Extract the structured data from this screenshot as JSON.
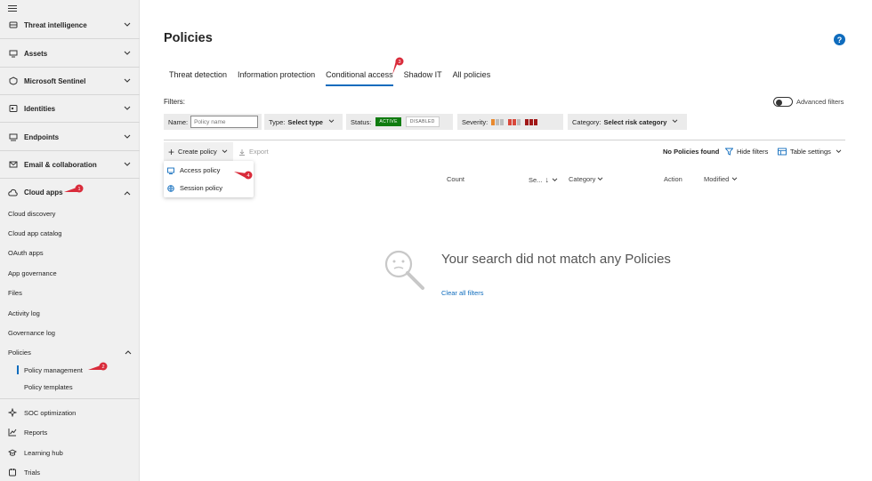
{
  "sidebar": {
    "groups": [
      {
        "label": "Threat intelligence",
        "icon": "shield-bug-icon"
      },
      {
        "label": "Assets",
        "icon": "assets-icon"
      },
      {
        "label": "Microsoft Sentinel",
        "icon": "sentinel-icon"
      },
      {
        "label": "Identities",
        "icon": "identities-icon"
      },
      {
        "label": "Endpoints",
        "icon": "endpoints-icon"
      },
      {
        "label": "Email & collaboration",
        "icon": "mail-icon"
      },
      {
        "label": "Cloud apps",
        "icon": "cloud-icon"
      }
    ],
    "cloud_apps_items": [
      "Cloud discovery",
      "Cloud app catalog",
      "OAuth apps",
      "App governance",
      "Files",
      "Activity log",
      "Governance log"
    ],
    "policies_label": "Policies",
    "policies_items": [
      "Policy management",
      "Policy templates"
    ],
    "bottom_items": [
      {
        "label": "SOC optimization",
        "icon": "soc-icon"
      },
      {
        "label": "Reports",
        "icon": "reports-icon"
      },
      {
        "label": "Learning hub",
        "icon": "learning-icon"
      },
      {
        "label": "Trials",
        "icon": "trials-icon"
      }
    ]
  },
  "callouts": [
    "1",
    "2",
    "3",
    "4"
  ],
  "page": {
    "title": "Policies",
    "help": "?",
    "tabs": [
      "Threat detection",
      "Information protection",
      "Conditional access",
      "Shadow IT",
      "All policies"
    ],
    "active_tab": "Conditional access"
  },
  "filters": {
    "label": "Filters:",
    "advanced_label": "Advanced filters",
    "name_label": "Name:",
    "name_placeholder": "Policy name",
    "type_label": "Type:",
    "type_value": "Select type",
    "status_label": "Status:",
    "status_active": "ACTIVE",
    "status_disabled": "DISABLED",
    "severity_label": "Severity:",
    "category_label": "Category:",
    "category_value": "Select risk category"
  },
  "toolbar": {
    "create_label": "Create policy",
    "export_label": "Export",
    "no_policies": "No Policies found",
    "hide_filters": "Hide filters",
    "table_settings": "Table settings"
  },
  "dropdown": {
    "items": [
      "Access policy",
      "Session policy"
    ]
  },
  "columns": [
    "Count",
    "Se...",
    "Category",
    "Action",
    "Modified"
  ],
  "empty": {
    "title": "Your search did not match any Policies",
    "link": "Clear all filters"
  },
  "colors": {
    "accent": "#0f6cbd",
    "active_green": "#107c10",
    "callout_red": "#d92b3a",
    "sev_low": "#e8892e",
    "sev_medium": "#d9473a",
    "sev_high": "#a11818"
  }
}
